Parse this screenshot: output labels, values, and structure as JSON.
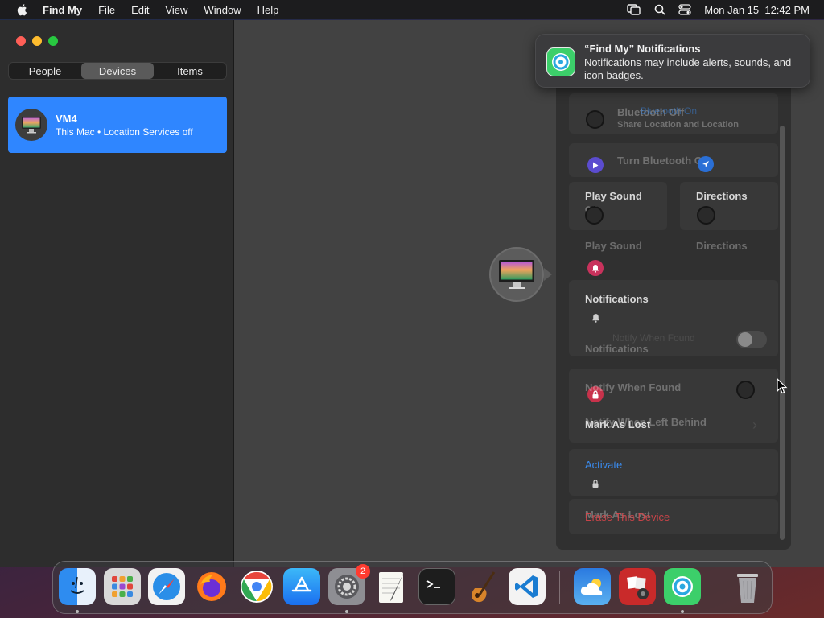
{
  "menubar": {
    "app_name": "Find My",
    "menus": [
      "File",
      "Edit",
      "View",
      "Window",
      "Help"
    ],
    "datetime": "Mon Jan 15  12:42 PM",
    "status_icons": [
      "screen-mirroring-icon",
      "search-icon",
      "control-center-icon"
    ]
  },
  "sidebar": {
    "tabs": [
      {
        "label": "People",
        "active": false
      },
      {
        "label": "Devices",
        "active": true
      },
      {
        "label": "Items",
        "active": false
      }
    ],
    "devices": [
      {
        "name": "VM4",
        "subtitle": "This Mac • Location Services off",
        "icon": "imac-icon",
        "selected": true
      }
    ]
  },
  "panel": {
    "bluetooth_off": "Bluetooth Off",
    "bluetooth_on_ghost": "Bluetooth On",
    "bluetooth_ghost_sub": "Share Location and Location",
    "turn_bluetooth_on": "Turn Bluetooth On",
    "play_sound": "Play Sound",
    "play_sound_sub": "Off",
    "directions": "Directions",
    "play_sound_ghost": "Play Sound",
    "directions_ghost": "Directions",
    "notifications": "Notifications",
    "notify_when_found_ghost": "Notify When Found",
    "notifications_ghost": "Notifications",
    "notify_when_found": "Notify When Found",
    "notify_when_left_behind": "Notify When Left Behind",
    "mark_as_lost": "Mark As Lost",
    "activate": "Activate",
    "mark_as_lost_ghost": "Mark As Lost",
    "erase_this_device": "Erase This Device"
  },
  "notification": {
    "title": "“Find My” Notifications",
    "body": "Notifications may include alerts, sounds, and icon badges."
  },
  "dock": {
    "apps": [
      "Finder",
      "Launchpad",
      "Safari",
      "Firefox",
      "Chrome",
      "App Store",
      "System Settings",
      "TextEdit",
      "Terminal",
      "GarageBand",
      "Visual Studio Code",
      "Weather",
      "Photo Booth",
      "Find My",
      "Trash"
    ],
    "settings_badge": "2"
  },
  "colors": {
    "accent": "#2f86ff",
    "menubar": "#1c1c1e",
    "sidebar": "#2d2d2d",
    "map": "#424242",
    "red": "#e0464b"
  }
}
